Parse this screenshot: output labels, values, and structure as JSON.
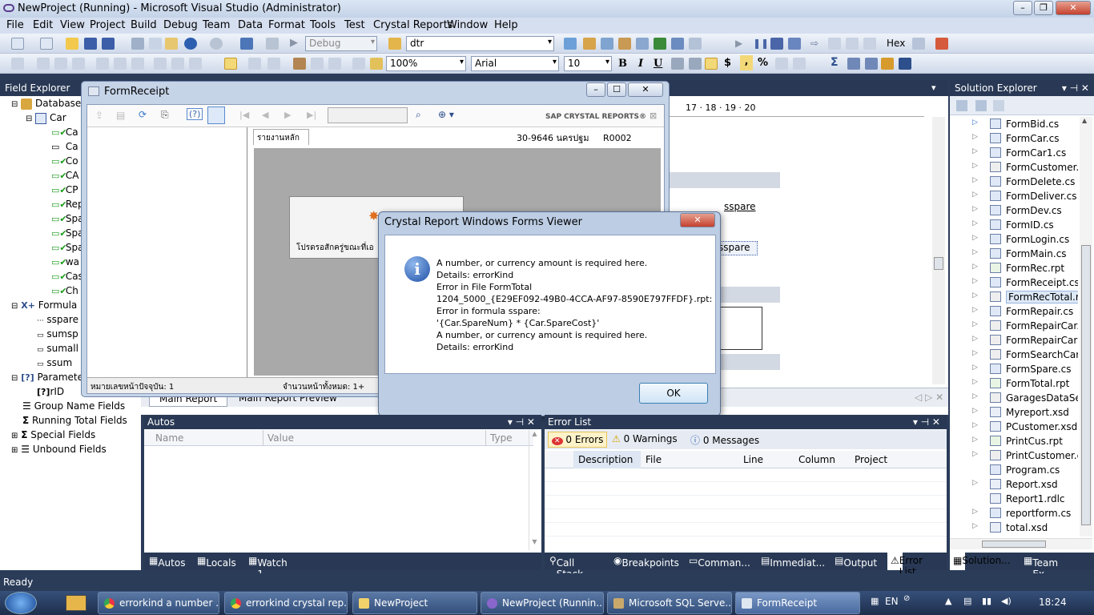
{
  "window": {
    "title": "NewProject (Running) - Microsoft Visual Studio (Administrator)"
  },
  "menu": [
    "File",
    "Edit",
    "View",
    "Project",
    "Build",
    "Debug",
    "Team",
    "Data",
    "Format",
    "Tools",
    "Test",
    "Crystal Reports",
    "Window",
    "Help"
  ],
  "toolbar": {
    "config": "Debug",
    "search": "dtr",
    "zoom": "100%",
    "font": "Arial",
    "size": "10"
  },
  "fieldExplorer": {
    "title": "Field Explorer",
    "items": [
      "Database F",
      "Car",
      "Ca",
      "Ca",
      "Co",
      "CA",
      "CP",
      "Rep",
      "Spa",
      "Spa",
      "Spa",
      "wa",
      "Cas",
      "Ch",
      "Formula F",
      "sspare",
      "sumsp",
      "sumall",
      "ssum",
      "Parameter",
      "rID",
      "Group Name Fields",
      "Running Total Fields",
      "Special Fields",
      "Unbound Fields"
    ]
  },
  "formReceipt": {
    "title": "FormReceipt",
    "brand": "SAP CRYSTAL REPORTS®",
    "tab": "รายงานหลัก",
    "header": "30-9646 นครปฐม     R0002",
    "loading": "โปรดรอสักครู่ขณะที่เอ",
    "status_left": "หมายเลขหน้าปัจจุบัน: 1",
    "status_right": "จำนวนหน้าทั้งหมด: 1+"
  },
  "designer": {
    "ruler": "17 · 18 · 19 · 20",
    "field1": "sspare",
    "field2": "sspare",
    "tabs": [
      "Main Report",
      "Main Report Preview"
    ]
  },
  "dialog": {
    "title": "Crystal Report Windows Forms Viewer",
    "lines": [
      "A number, or currency amount is required here.",
      "Details: errorKind",
      "Error in File FormTotal",
      "1204_5000_{E29EF092-49B0-4CCA-AF97-8590E797FFDF}.rpt:",
      "Error in formula  sspare:",
      "'{Car.SpareNum} * {Car.SpareCost}'",
      "A number, or currency amount is required here.",
      "Details: errorKind"
    ],
    "ok": "OK"
  },
  "autos": {
    "title": "Autos",
    "columns": [
      "Name",
      "Value",
      "Type"
    ],
    "tabs": [
      "Autos",
      "Locals",
      "Watch 1"
    ]
  },
  "errorList": {
    "title": "Error List",
    "errors": "0 Errors",
    "warnings": "0 Warnings",
    "messages": "0 Messages",
    "columns": [
      "Description",
      "File",
      "Line",
      "Column",
      "Project"
    ],
    "tabs": [
      "Call Stack",
      "Breakpoints",
      "Comman...",
      "Immediat...",
      "Output",
      "Error List"
    ]
  },
  "solutionExplorer": {
    "title": "Solution Explorer",
    "files": [
      "FormBid.cs",
      "FormCar.cs",
      "FormCar1.cs",
      "FormCustomer.c",
      "FormDelete.cs",
      "FormDeliver.cs",
      "FormDev.cs",
      "FormID.cs",
      "FormLogin.cs",
      "FormMain.cs",
      "FormRec.rpt",
      "FormReceipt.cs",
      "FormRecTotal.rp",
      "FormRepair.cs",
      "FormRepairCar.c",
      "FormRepairCar1",
      "FormSearchCar.c",
      "FormSpare.cs",
      "FormTotal.rpt",
      "GaragesDataSet.:",
      "Myreport.xsd",
      "PCustomer.xsd",
      "PrintCus.rpt",
      "PrintCustomer.c",
      "Program.cs",
      "Report.xsd",
      "Report1.rdlc",
      "reportform.cs",
      "total.xsd"
    ],
    "tabs": [
      "Solution...",
      "Team Ex..."
    ]
  },
  "statusbar": "Ready",
  "taskbar": {
    "items": [
      "errorkind a number ...",
      "errorkind crystal rep...",
      "NewProject",
      "NewProject (Runnin...",
      "Microsoft SQL Serve...",
      "FormReceipt"
    ],
    "lang": "EN",
    "time": "18:24"
  }
}
